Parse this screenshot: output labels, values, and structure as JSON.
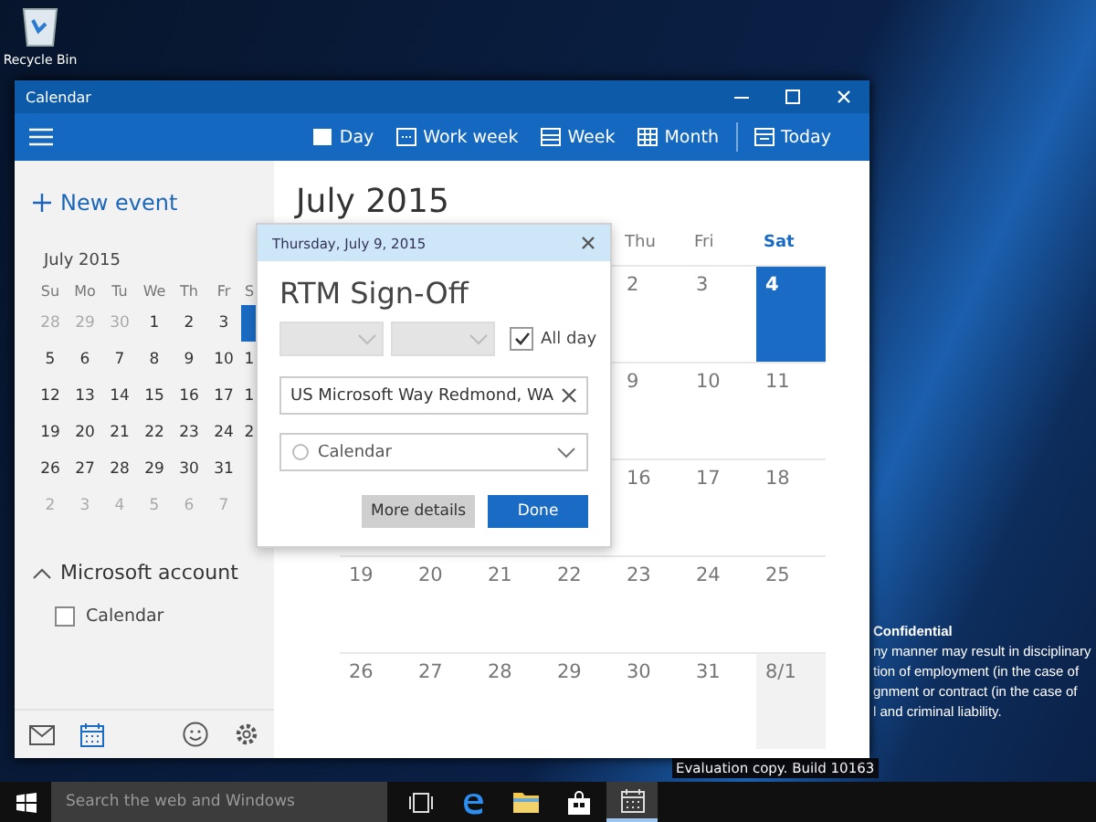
{
  "desktop": {
    "icons": [
      {
        "label": "Recycle Bin"
      }
    ],
    "notice_lines": [
      {
        "text": "Confidential",
        "kind": "heading"
      },
      {
        "text": "ny manner may result in disciplinary",
        "kind": "body"
      },
      {
        "text": "tion of employment (in the case of",
        "kind": "body"
      },
      {
        "text": "gnment or contract (in the case of",
        "kind": "body"
      },
      {
        "text": "l and criminal liability.",
        "kind": "body"
      }
    ],
    "build_text": "Evaluation copy. Build 10163"
  },
  "window": {
    "title": "Calendar"
  },
  "toolbar": {
    "views": [
      {
        "label": "Day",
        "kind": "day"
      },
      {
        "label": "Work week",
        "kind": "workweek"
      },
      {
        "label": "Week",
        "kind": "week"
      },
      {
        "label": "Month",
        "kind": "month"
      }
    ],
    "today": "Today"
  },
  "sidebar": {
    "new_event": "New event",
    "mini_calendar": {
      "title": "July 2015",
      "weekdays": [
        "Su",
        "Mo",
        "Tu",
        "We",
        "Th",
        "Fr",
        "S"
      ],
      "weeks": [
        [
          {
            "day": "28",
            "muted": true,
            "today": false
          },
          {
            "day": "29",
            "muted": true,
            "today": false
          },
          {
            "day": "30",
            "muted": true,
            "today": false
          },
          {
            "day": "1",
            "muted": false,
            "today": false
          },
          {
            "day": "2",
            "muted": false,
            "today": false
          },
          {
            "day": "3",
            "muted": false,
            "today": false
          },
          {
            "muted": false,
            "today": true
          }
        ],
        [
          {
            "day": "5",
            "muted": false,
            "today": false
          },
          {
            "day": "6",
            "muted": false,
            "today": false
          },
          {
            "day": "7",
            "muted": false,
            "today": false
          },
          {
            "day": "8",
            "muted": false,
            "today": false
          },
          {
            "day": "9",
            "muted": false,
            "today": false
          },
          {
            "day": "10",
            "muted": false,
            "today": false
          },
          {
            "day": "1",
            "muted": false,
            "today": false
          }
        ],
        [
          {
            "day": "12",
            "muted": false,
            "today": false
          },
          {
            "day": "13",
            "muted": false,
            "today": false
          },
          {
            "day": "14",
            "muted": false,
            "today": false
          },
          {
            "day": "15",
            "muted": false,
            "today": false
          },
          {
            "day": "16",
            "muted": false,
            "today": false
          },
          {
            "day": "17",
            "muted": false,
            "today": false
          },
          {
            "day": "1",
            "muted": false,
            "today": false
          }
        ],
        [
          {
            "day": "19",
            "muted": false,
            "today": false
          },
          {
            "day": "20",
            "muted": false,
            "today": false
          },
          {
            "day": "21",
            "muted": false,
            "today": false
          },
          {
            "day": "22",
            "muted": false,
            "today": false
          },
          {
            "day": "23",
            "muted": false,
            "today": false
          },
          {
            "day": "24",
            "muted": false,
            "today": false
          },
          {
            "day": "2",
            "muted": false,
            "today": false
          }
        ],
        [
          {
            "day": "26",
            "muted": false,
            "today": false
          },
          {
            "day": "27",
            "muted": false,
            "today": false
          },
          {
            "day": "28",
            "muted": false,
            "today": false
          },
          {
            "day": "29",
            "muted": false,
            "today": false
          },
          {
            "day": "30",
            "muted": false,
            "today": false
          },
          {
            "day": "31",
            "muted": false,
            "today": false
          }
        ],
        [
          {
            "day": "2",
            "muted": true,
            "today": false
          },
          {
            "day": "3",
            "muted": true,
            "today": false
          },
          {
            "day": "4",
            "muted": true,
            "today": false
          },
          {
            "day": "5",
            "muted": true,
            "today": false
          },
          {
            "day": "6",
            "muted": true,
            "today": false
          },
          {
            "day": "7",
            "muted": true,
            "today": false
          }
        ]
      ]
    },
    "accounts": [
      {
        "name": "Microsoft account",
        "expanded": true,
        "calendars": [
          {
            "label": "Calendar",
            "checked": false
          }
        ]
      }
    ]
  },
  "nav": [
    {
      "kind": "mail",
      "selected": false
    },
    {
      "kind": "calendar",
      "selected": true
    },
    {
      "kind": "feedback",
      "selected": false
    },
    {
      "kind": "settings",
      "selected": false
    }
  ],
  "main": {
    "month_title": "July 2015",
    "weekdays": [
      {
        "label": "Thu",
        "selected": false
      },
      {
        "label": "Fri",
        "selected": false
      },
      {
        "label": "Sat",
        "selected": true
      }
    ],
    "weeks": [
      [
        {
          "day": "2",
          "today": false,
          "muted": false
        },
        {
          "day": "3",
          "today": false,
          "muted": false
        },
        {
          "day": "4",
          "today": true,
          "muted": false
        }
      ],
      [
        {
          "day": "9",
          "today": false,
          "muted": false
        },
        {
          "day": "10",
          "today": false,
          "muted": false
        },
        {
          "day": "11",
          "today": false,
          "muted": false
        }
      ],
      [
        {
          "day": "16",
          "today": false,
          "muted": false
        },
        {
          "day": "17",
          "today": false,
          "muted": false
        },
        {
          "day": "18",
          "today": false,
          "muted": false
        }
      ],
      [
        {
          "day": "19",
          "today": false,
          "muted": false
        },
        {
          "day": "20",
          "today": false,
          "muted": false
        },
        {
          "day": "21",
          "today": false,
          "muted": false
        },
        {
          "day": "22",
          "today": false,
          "muted": false
        },
        {
          "day": "23",
          "today": false,
          "muted": false
        },
        {
          "day": "24",
          "today": false,
          "muted": false
        },
        {
          "day": "25",
          "today": false,
          "muted": false
        }
      ],
      [
        {
          "day": "26",
          "today": false,
          "muted": false
        },
        {
          "day": "27",
          "today": false,
          "muted": false
        },
        {
          "day": "28",
          "today": false,
          "muted": false
        },
        {
          "day": "29",
          "today": false,
          "muted": false
        },
        {
          "day": "30",
          "today": false,
          "muted": false
        },
        {
          "day": "31",
          "today": false,
          "muted": false
        },
        {
          "day": "8/1",
          "today": false,
          "muted": true
        }
      ]
    ]
  },
  "popup": {
    "date": "Thursday, July 9, 2015",
    "title": "RTM Sign-Off",
    "time_fields": [
      {
        "disabled": true
      },
      {
        "disabled": true
      }
    ],
    "all_day": {
      "label": "All day",
      "checked": true
    },
    "location": "US Microsoft Way Redmond, WA",
    "calendar": "Calendar",
    "buttons": [
      {
        "label": "More details",
        "kind": "secondary"
      },
      {
        "label": "Done",
        "kind": "primary"
      }
    ]
  },
  "taskbar": {
    "search": {
      "placeholder": "Search the web and Windows"
    },
    "apps": [
      {
        "kind": "taskview",
        "active": false
      },
      {
        "kind": "edge",
        "active": false
      },
      {
        "kind": "explorer",
        "active": false
      },
      {
        "kind": "store",
        "active": false
      },
      {
        "kind": "calendar",
        "active": true
      }
    ]
  }
}
